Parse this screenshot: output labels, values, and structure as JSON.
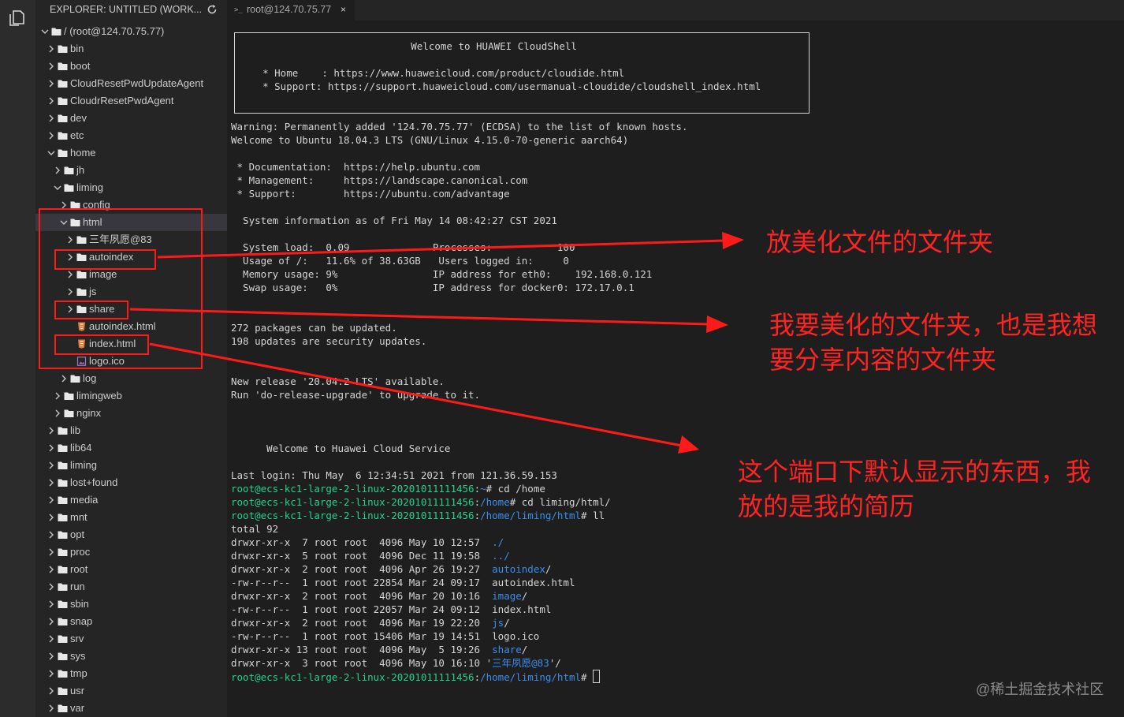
{
  "sidebar": {
    "title": "EXPLORER: UNTITLED (WORK...",
    "items": [
      {
        "label": "/ (root@124.70.75.77)",
        "type": "folder",
        "depth": 0,
        "expanded": true
      },
      {
        "label": "bin",
        "type": "folder",
        "depth": 1,
        "expanded": false
      },
      {
        "label": "boot",
        "type": "folder",
        "depth": 1,
        "expanded": false
      },
      {
        "label": "CloudResetPwdUpdateAgent",
        "type": "folder",
        "depth": 1,
        "expanded": false
      },
      {
        "label": "CloudrResetPwdAgent",
        "type": "folder",
        "depth": 1,
        "expanded": false
      },
      {
        "label": "dev",
        "type": "folder",
        "depth": 1,
        "expanded": false
      },
      {
        "label": "etc",
        "type": "folder",
        "depth": 1,
        "expanded": false
      },
      {
        "label": "home",
        "type": "folder",
        "depth": 1,
        "expanded": true
      },
      {
        "label": "jh",
        "type": "folder",
        "depth": 2,
        "expanded": false
      },
      {
        "label": "liming",
        "type": "folder",
        "depth": 2,
        "expanded": true
      },
      {
        "label": "config",
        "type": "folder",
        "depth": 3,
        "expanded": false
      },
      {
        "label": "html",
        "type": "folder",
        "depth": 3,
        "expanded": true,
        "selected": true
      },
      {
        "label": "三年夙愿@83",
        "type": "folder",
        "depth": 4,
        "expanded": false
      },
      {
        "label": "autoindex",
        "type": "folder",
        "depth": 4,
        "expanded": false
      },
      {
        "label": "image",
        "type": "folder",
        "depth": 4,
        "expanded": false
      },
      {
        "label": "js",
        "type": "folder",
        "depth": 4,
        "expanded": false
      },
      {
        "label": "share",
        "type": "folder",
        "depth": 4,
        "expanded": false
      },
      {
        "label": "autoindex.html",
        "type": "html",
        "depth": 4
      },
      {
        "label": "index.html",
        "type": "html",
        "depth": 4
      },
      {
        "label": "logo.ico",
        "type": "image",
        "depth": 4
      },
      {
        "label": "log",
        "type": "folder",
        "depth": 3,
        "expanded": false
      },
      {
        "label": "limingweb",
        "type": "folder",
        "depth": 2,
        "expanded": false
      },
      {
        "label": "nginx",
        "type": "folder",
        "depth": 2,
        "expanded": false
      },
      {
        "label": "lib",
        "type": "folder",
        "depth": 1,
        "expanded": false
      },
      {
        "label": "lib64",
        "type": "folder",
        "depth": 1,
        "expanded": false
      },
      {
        "label": "liming",
        "type": "folder",
        "depth": 1,
        "expanded": false
      },
      {
        "label": "lost+found",
        "type": "folder",
        "depth": 1,
        "expanded": false
      },
      {
        "label": "media",
        "type": "folder",
        "depth": 1,
        "expanded": false
      },
      {
        "label": "mnt",
        "type": "folder",
        "depth": 1,
        "expanded": false
      },
      {
        "label": "opt",
        "type": "folder",
        "depth": 1,
        "expanded": false
      },
      {
        "label": "proc",
        "type": "folder",
        "depth": 1,
        "expanded": false
      },
      {
        "label": "root",
        "type": "folder",
        "depth": 1,
        "expanded": false
      },
      {
        "label": "run",
        "type": "folder",
        "depth": 1,
        "expanded": false
      },
      {
        "label": "sbin",
        "type": "folder",
        "depth": 1,
        "expanded": false
      },
      {
        "label": "snap",
        "type": "folder",
        "depth": 1,
        "expanded": false
      },
      {
        "label": "srv",
        "type": "folder",
        "depth": 1,
        "expanded": false
      },
      {
        "label": "sys",
        "type": "folder",
        "depth": 1,
        "expanded": false
      },
      {
        "label": "tmp",
        "type": "folder",
        "depth": 1,
        "expanded": false
      },
      {
        "label": "usr",
        "type": "folder",
        "depth": 1,
        "expanded": false
      },
      {
        "label": "var",
        "type": "folder",
        "depth": 1,
        "expanded": false
      }
    ]
  },
  "tab": {
    "icon": ">_",
    "label": "root@124.70.75.77",
    "close": "×"
  },
  "terminal": {
    "lines": [
      [
        {
          "t": "                             Welcome to HUAWEI CloudShell"
        }
      ],
      [
        {
          "t": ""
        }
      ],
      [
        {
          "t": "    * Home    : https://www.huaweicloud.com/product/cloudide.html"
        }
      ],
      [
        {
          "t": "    * Support: https://support.huaweicloud.com/usermanual-cloudide/cloudshell_index.html"
        }
      ],
      [
        {
          "t": ""
        }
      ],
      [
        {
          "t": ""
        }
      ],
      [
        {
          "t": "Warning: Permanently added '124.70.75.77' (ECDSA) to the list of known hosts."
        }
      ],
      [
        {
          "t": "Welcome to Ubuntu 18.04.3 LTS (GNU/Linux 4.15.0-70-generic aarch64)"
        }
      ],
      [
        {
          "t": ""
        }
      ],
      [
        {
          "t": " * Documentation:  https://help.ubuntu.com"
        }
      ],
      [
        {
          "t": " * Management:     https://landscape.canonical.com"
        }
      ],
      [
        {
          "t": " * Support:        https://ubuntu.com/advantage"
        }
      ],
      [
        {
          "t": ""
        }
      ],
      [
        {
          "t": "  System information as of Fri May 14 08:42:27 CST 2021"
        }
      ],
      [
        {
          "t": ""
        }
      ],
      [
        {
          "t": "  System load:  0.09              Processes:           100"
        }
      ],
      [
        {
          "t": "  Usage of /:   11.6% of 38.63GB   Users logged in:     0"
        }
      ],
      [
        {
          "t": "  Memory usage: 9%                IP address for eth0:    192.168.0.121"
        }
      ],
      [
        {
          "t": "  Swap usage:   0%                IP address for docker0: 172.17.0.1"
        }
      ],
      [
        {
          "t": ""
        }
      ],
      [
        {
          "t": ""
        }
      ],
      [
        {
          "t": "272 packages can be updated."
        }
      ],
      [
        {
          "t": "198 updates are security updates."
        }
      ],
      [
        {
          "t": ""
        }
      ],
      [
        {
          "t": ""
        }
      ],
      [
        {
          "t": "New release '20.04.2 LTS' available."
        }
      ],
      [
        {
          "t": "Run 'do-release-upgrade' to upgrade to it."
        }
      ],
      [
        {
          "t": ""
        }
      ],
      [
        {
          "t": ""
        }
      ],
      [
        {
          "t": ""
        }
      ],
      [
        {
          "t": "      Welcome to Huawei Cloud Service"
        }
      ],
      [
        {
          "t": ""
        }
      ],
      [
        {
          "t": "Last login: Thu May  6 12:34:51 2021 from 121.36.59.153"
        }
      ],
      [
        {
          "t": "root@ecs-kc1-large-2-linux-20201011111456",
          "c": "green"
        },
        {
          "t": ":"
        },
        {
          "t": "~",
          "c": "blue"
        },
        {
          "t": "# cd /home"
        }
      ],
      [
        {
          "t": "root@ecs-kc1-large-2-linux-20201011111456",
          "c": "green"
        },
        {
          "t": ":"
        },
        {
          "t": "/home",
          "c": "blue"
        },
        {
          "t": "# cd liming/html/"
        }
      ],
      [
        {
          "t": "root@ecs-kc1-large-2-linux-20201011111456",
          "c": "green"
        },
        {
          "t": ":"
        },
        {
          "t": "/home/liming/html",
          "c": "blue"
        },
        {
          "t": "# ll"
        }
      ],
      [
        {
          "t": "total 92"
        }
      ],
      [
        {
          "t": "drwxr-xr-x  7 root root  4096 May 10 12:57  "
        },
        {
          "t": "./",
          "c": "blue"
        }
      ],
      [
        {
          "t": "drwxr-xr-x  5 root root  4096 Dec 11 19:58  "
        },
        {
          "t": "../",
          "c": "blue"
        }
      ],
      [
        {
          "t": "drwxr-xr-x  2 root root  4096 Apr 26 19:27  "
        },
        {
          "t": "autoindex",
          "c": "blue"
        },
        {
          "t": "/"
        }
      ],
      [
        {
          "t": "-rw-r--r--  1 root root 22854 Mar 24 09:17  autoindex.html"
        }
      ],
      [
        {
          "t": "drwxr-xr-x  2 root root  4096 Mar 20 10:16  "
        },
        {
          "t": "image",
          "c": "blue"
        },
        {
          "t": "/"
        }
      ],
      [
        {
          "t": "-rw-r--r--  1 root root 22057 Mar 24 09:12  index.html"
        }
      ],
      [
        {
          "t": "drwxr-xr-x  2 root root  4096 Mar 19 22:20  "
        },
        {
          "t": "js",
          "c": "blue"
        },
        {
          "t": "/"
        }
      ],
      [
        {
          "t": "-rw-r--r--  1 root root 15406 Mar 19 14:51  logo.ico"
        }
      ],
      [
        {
          "t": "drwxr-xr-x 13 root root  4096 May  5 19:26  "
        },
        {
          "t": "share",
          "c": "blue"
        },
        {
          "t": "/"
        }
      ],
      [
        {
          "t": "drwxr-xr-x  3 root root  4096 May 10 16:10 '"
        },
        {
          "t": "三年夙愿@83",
          "c": "blue"
        },
        {
          "t": "'/"
        }
      ],
      [
        {
          "t": "root@ecs-kc1-large-2-linux-20201011111456",
          "c": "green"
        },
        {
          "t": ":"
        },
        {
          "t": "/home/liming/html",
          "c": "blue"
        },
        {
          "t": "# "
        },
        {
          "cursor": true
        }
      ]
    ]
  },
  "annotations": {
    "note1": "放美化文件的文件夹",
    "note2": [
      "我要美化的文件夹，也是我想",
      "要分享内容的文件夹"
    ],
    "note3": [
      "这个端口下默认显示的东西，我",
      "放的是我的简历"
    ],
    "color": "#ff1a1a"
  },
  "watermark": "@稀土掘金技术社区"
}
